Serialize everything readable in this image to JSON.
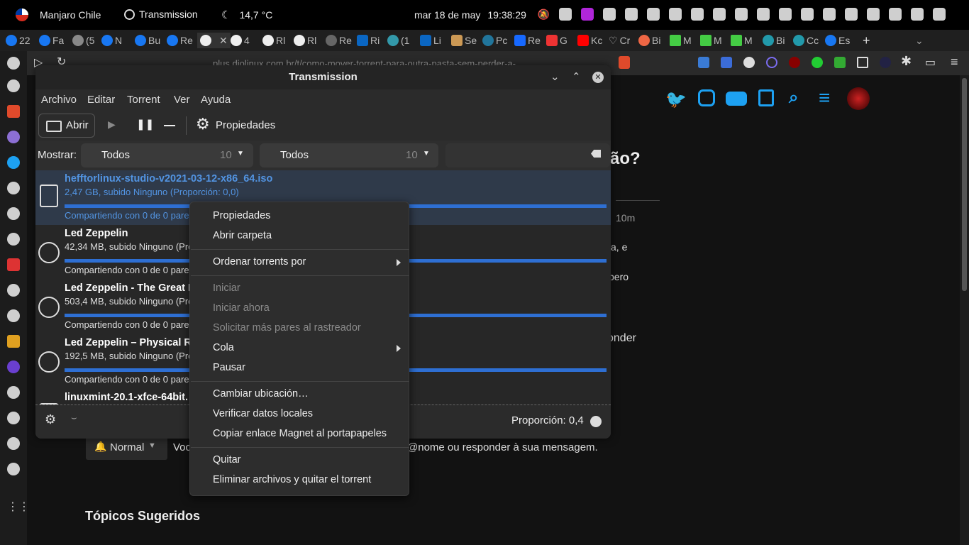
{
  "topbar": {
    "distro": "Manjaro Chile",
    "active_app": "Transmission",
    "weather": "14,7 °C",
    "date": "mar 18 de may",
    "time": "19:38:29"
  },
  "browser": {
    "tabs": [
      "22",
      "Fa",
      "(5",
      "N",
      "Bu",
      "Re",
      "",
      "4",
      "Rl",
      "Rl",
      "Re",
      "Ri",
      "(1",
      "Li",
      "Se",
      "Pc",
      "Re",
      "G",
      "Kc",
      "Cr",
      "Bi",
      "M",
      "M",
      "M",
      "Bi",
      "Cc",
      "Es"
    ],
    "url": "plus.diolinux.com.br/t/como-mover-torrent-para-outra-pasta-sem-perder-a-"
  },
  "webpage": {
    "heading_fragment": "ão?",
    "time_fragment": "10m",
    "text1": "a, e",
    "text2": "pero",
    "reply_fragment": "onder",
    "notify_label": "Normal",
    "notify_text_left": "Voc",
    "notify_text_right": "@nome ou responder à sua mensagem.",
    "suggested": "Tópicos Sugeridos"
  },
  "transmission": {
    "title": "Transmission",
    "menu": [
      "Archivo",
      "Editar",
      "Torrent",
      "Ver",
      "Ayuda"
    ],
    "open_label": "Abrir",
    "properties_label": "Propiedades",
    "show_label": "Mostrar:",
    "filter1": {
      "label": "Todos",
      "count": "10"
    },
    "filter2": {
      "label": "Todos",
      "count": "10"
    },
    "torrents": [
      {
        "name": "hefftorlinux-studio-v2021-03-12-x86_64.iso",
        "size": "2,47 GB, subido Ninguno (Proporción: 0,0)",
        "status": "Compartiendo con 0 de 0 pare",
        "progress": 1.0
      },
      {
        "name": "Led Zeppelin",
        "size": "42,34 MB, subido Ninguno (Pro",
        "status": "Compartiendo con 0 de 0 pare",
        "progress": 1.0
      },
      {
        "name": "Led Zeppelin - The Great L",
        "size": "503,4 MB, subido Ninguno (Pro",
        "status": "Compartiendo con 0 de 0 pare",
        "progress": 1.0
      },
      {
        "name": "Led Zeppelin – Physical Ra",
        "size": "192,5 MB, subido Ninguno (Pro",
        "status": "Compartiendo con 0 de 0 pare",
        "progress": 1.0
      },
      {
        "name": "linuxmint-20.1-xfce-64bit.",
        "size": "",
        "status": "",
        "progress": 1.0
      }
    ],
    "ratio": "Proporción: 0,4"
  },
  "context_menu": {
    "items": [
      "Propiedades",
      "Abrir carpeta",
      "Ordenar torrents por",
      "Iniciar",
      "Iniciar ahora",
      "Solicitar más pares al rastreador",
      "Cola",
      "Pausar",
      "Cambiar ubicación…",
      "Verificar datos locales",
      "Copiar enlace Magnet al portapapeles",
      "Quitar",
      "Eliminar archivos y quitar el torrent"
    ]
  }
}
